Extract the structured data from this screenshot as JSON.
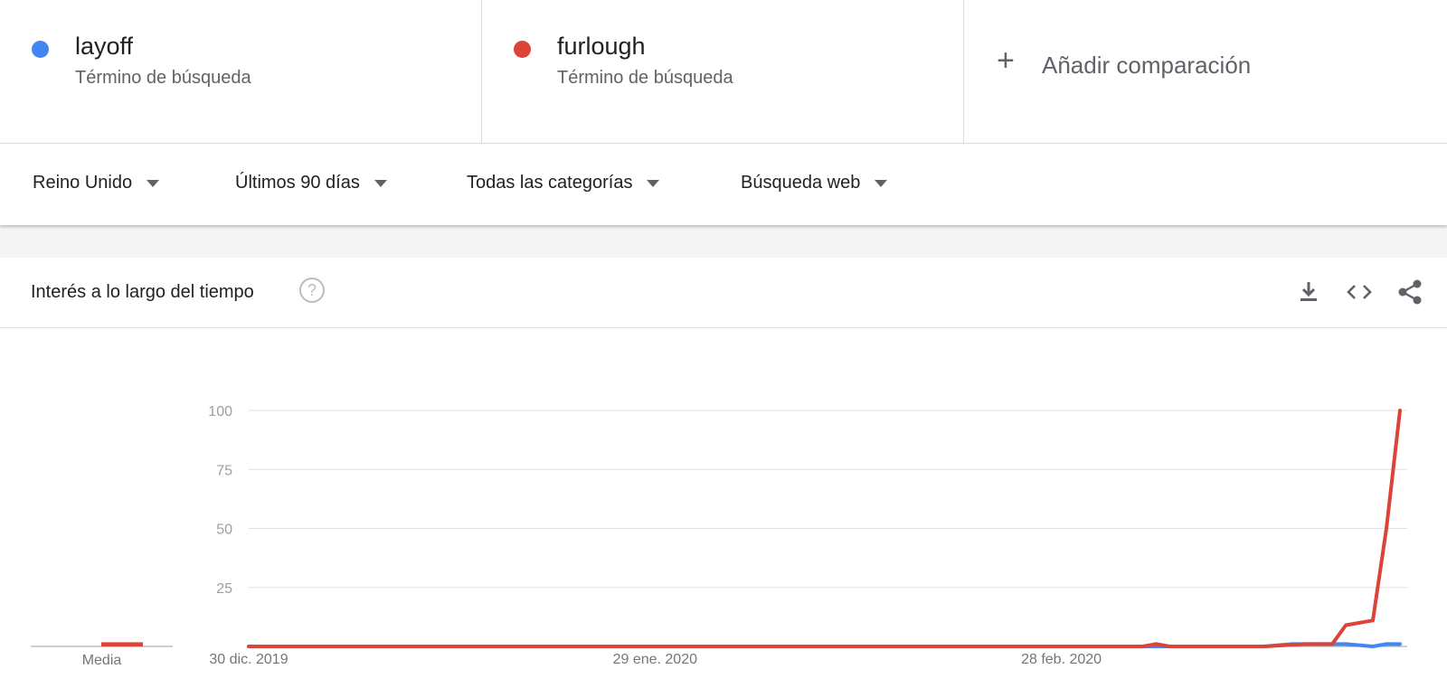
{
  "terms": [
    {
      "name": "layoff",
      "kind": "Término de búsqueda",
      "color": "#4285f4"
    },
    {
      "name": "furlough",
      "kind": "Término de búsqueda",
      "color": "#db4437"
    }
  ],
  "add_comparison": {
    "label": "Añadir comparación",
    "icon": "plus-icon"
  },
  "filters": {
    "region": "Reino Unido",
    "period": "Últimos 90 días",
    "category": "Todas las categorías",
    "search_type": "Búsqueda web"
  },
  "card": {
    "title": "Interés a lo largo del tiempo",
    "icons": [
      "help-icon",
      "download-icon",
      "embed-code-icon",
      "share-icon"
    ]
  },
  "chart_data": {
    "type": "line",
    "yticks": [
      25,
      50,
      75,
      100
    ],
    "ylim": [
      0,
      100
    ],
    "xticks": [
      "30 dic. 2019",
      "29 ene. 2020",
      "28 feb. 2020"
    ],
    "x_range": [
      "2019-12-30",
      "2020-03-24"
    ],
    "average_label": "Media",
    "averages": [
      {
        "series": "layoff",
        "value": 0
      },
      {
        "series": "furlough",
        "value": 1
      }
    ],
    "series": [
      {
        "name": "layoff",
        "color": "#4285f4",
        "points": [
          [
            "2019-12-30",
            0
          ],
          [
            "2020-03-14",
            0
          ],
          [
            "2020-03-16",
            1
          ],
          [
            "2020-03-20",
            1
          ],
          [
            "2020-03-22",
            0
          ],
          [
            "2020-03-23",
            1
          ],
          [
            "2020-03-24",
            1
          ]
        ]
      },
      {
        "name": "furlough",
        "color": "#db4437",
        "points": [
          [
            "2019-12-30",
            0
          ],
          [
            "2020-03-05",
            0
          ],
          [
            "2020-03-06",
            1
          ],
          [
            "2020-03-07",
            0
          ],
          [
            "2020-03-14",
            0
          ],
          [
            "2020-03-17",
            1
          ],
          [
            "2020-03-18",
            1
          ],
          [
            "2020-03-19",
            1
          ],
          [
            "2020-03-20",
            9
          ],
          [
            "2020-03-21",
            10
          ],
          [
            "2020-03-22",
            11
          ],
          [
            "2020-03-23",
            50
          ],
          [
            "2020-03-24",
            100
          ]
        ]
      }
    ]
  }
}
